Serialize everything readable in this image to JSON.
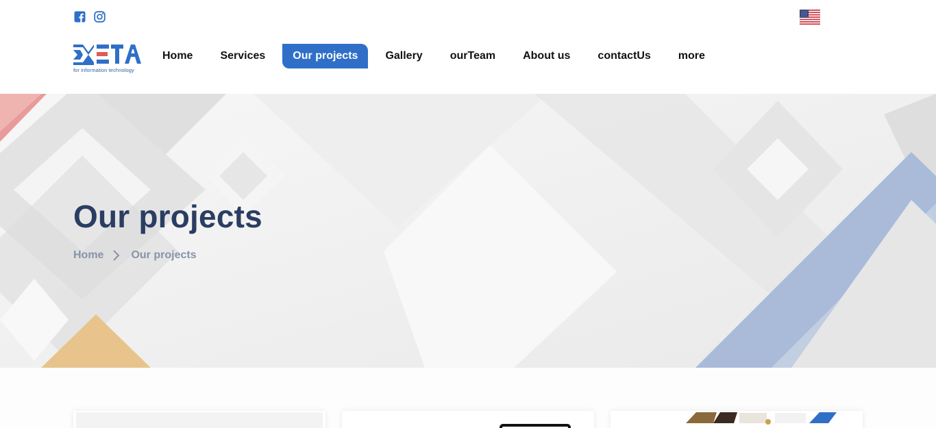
{
  "header": {
    "social": [
      {
        "name": "facebook-icon",
        "color": "#2f6fc8"
      },
      {
        "name": "instagram-icon",
        "color": "#2f6fc8"
      }
    ],
    "language_flag": "us-flag-icon",
    "logo": {
      "text": "META",
      "subtitle": "for information technology"
    }
  },
  "nav": {
    "items": [
      {
        "label": "Home"
      },
      {
        "label": "Services"
      },
      {
        "label": "Our projects",
        "active": true
      },
      {
        "label": "Gallery"
      },
      {
        "label": "ourTeam"
      },
      {
        "label": "About us"
      },
      {
        "label": "contactUs"
      },
      {
        "label": "more"
      }
    ],
    "active_color": "#2f6fc8"
  },
  "hero": {
    "title": "Our projects",
    "breadcrumb": {
      "home": "Home",
      "current": "Our projects"
    },
    "title_color": "#2a3d62"
  },
  "colors": {
    "accent_blue": "#2f6fc8",
    "accent_red": "#e05a5a",
    "accent_orange": "#e8a94a"
  }
}
